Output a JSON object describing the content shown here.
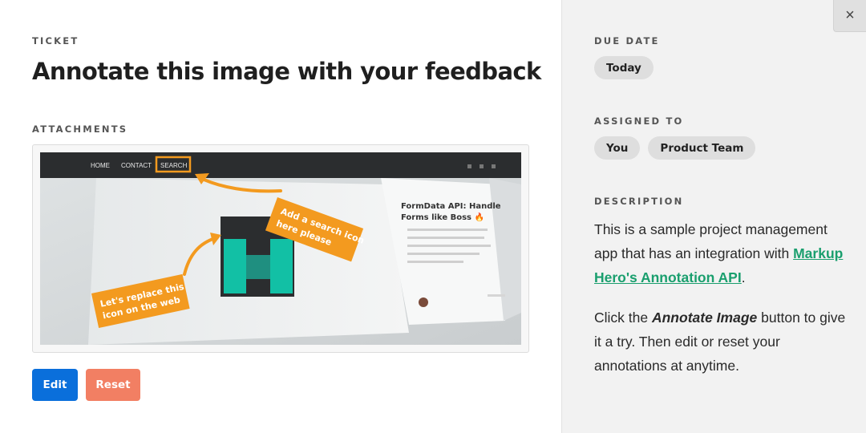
{
  "ticket": {
    "label": "TICKET",
    "title": "Annotate this image with your feedback",
    "attachments_label": "ATTACHMENTS",
    "attachment_preview": {
      "nav_items": [
        "HOME",
        "CONTACT",
        "SEARCH"
      ],
      "callout_top": [
        "Add a search icon",
        "here please"
      ],
      "callout_bottom": [
        "Let's replace this",
        "icon on the web"
      ],
      "card_heading": [
        "FormData API: Handle",
        "Forms like Boss 🔥"
      ]
    }
  },
  "actions": {
    "edit_label": "Edit",
    "reset_label": "Reset"
  },
  "sidebar": {
    "close_icon": "×",
    "due_date_label": "DUE DATE",
    "due_date_value": "Today",
    "assigned_label": "ASSIGNED TO",
    "assignees": [
      "You",
      "Product Team"
    ],
    "description_label": "DESCRIPTION",
    "description_p1_before": "This is a sample project management app that has an integration with",
    "description_link": "Markup Hero's Annotation API",
    "description_p1_after": ".",
    "description_p2_before": "Click the",
    "description_p2_emphasis": "Annotate Image",
    "description_p2_after": "button to give it a try. Then edit or reset your annotations at anytime."
  },
  "colors": {
    "primary": "#0a6fdb",
    "reset": "#f27f63",
    "link": "#1a9f6e",
    "annotation": "#f39a1f"
  }
}
